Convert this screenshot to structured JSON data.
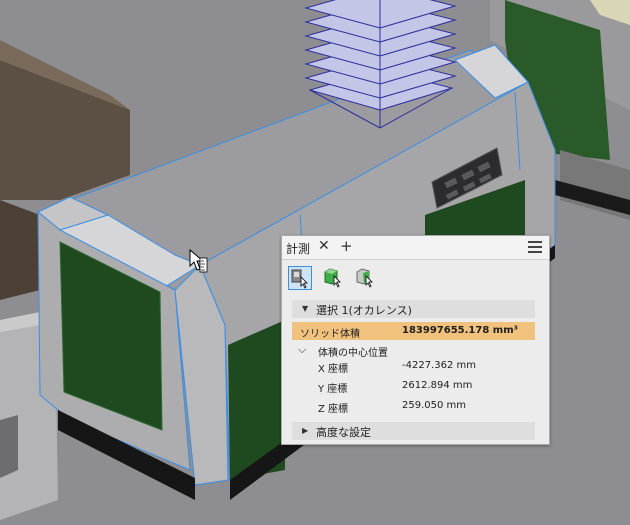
{
  "panel": {
    "tab_title": "計測",
    "close_glyph": "✕",
    "add_glyph": "+",
    "tools": [
      {
        "name": "select-component-tool",
        "active": true
      },
      {
        "name": "select-part-tool",
        "active": false
      },
      {
        "name": "select-body-tool",
        "active": false
      }
    ],
    "selection_header": "選択 1(オカレンス)",
    "volume_label": "ソリッド体積",
    "volume_value": "183997655.178 mm³",
    "center_header": "体積の中心位置",
    "coords": [
      {
        "label": "X 座標",
        "value": "-4227.362 mm"
      },
      {
        "label": "Y 座標",
        "value": "2612.894 mm"
      },
      {
        "label": "Z 座標",
        "value": "259.050 mm"
      }
    ],
    "advanced_label": "高度な設定"
  },
  "colors": {
    "accent": "#3d8fd6",
    "highlight": "#f1c27d",
    "panel_bg": "#ececec",
    "selection_edge": "#3a8ee6",
    "green_panel": "#1f4a20"
  }
}
